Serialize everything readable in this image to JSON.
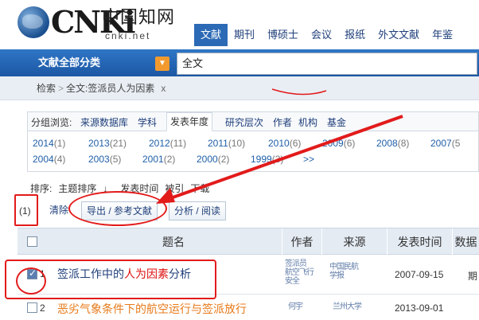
{
  "logo": {
    "word": "CNKi",
    "chinese": "中国知网",
    "url": "cnki.net"
  },
  "nav": [
    "文献",
    "期刊",
    "博硕士",
    "会议",
    "报纸",
    "外文文献",
    "年鉴"
  ],
  "search": {
    "category_label": "文献全部分类",
    "value": "全文"
  },
  "breadcrumb": {
    "home": "检索",
    "sep": ">",
    "current": "全文:签派员人为因素",
    "close": "x"
  },
  "filter": {
    "label": "分组浏览:",
    "tabs": [
      "来源数据库",
      "学科",
      "发表年度",
      "研究层次",
      "作者",
      "机构",
      "基金"
    ],
    "years_row1": [
      {
        "year": "2014",
        "count": "(1)"
      },
      {
        "year": "2013",
        "count": "(21)"
      },
      {
        "year": "2012",
        "count": "(11)"
      },
      {
        "year": "2011",
        "count": "(10)"
      },
      {
        "year": "2010",
        "count": "(6)"
      },
      {
        "year": "2009",
        "count": "(6)"
      },
      {
        "year": "2008",
        "count": "(8)"
      },
      {
        "year": "2007",
        "count": "(5"
      }
    ],
    "years_row2": [
      {
        "year": "2004",
        "count": "(4)"
      },
      {
        "year": "2003",
        "count": "(5)"
      },
      {
        "year": "2001",
        "count": "(2)"
      },
      {
        "year": "2000",
        "count": "(2)"
      },
      {
        "year": "1999",
        "count": "(3)"
      }
    ],
    "more": ">>"
  },
  "sort": {
    "label": "排序:",
    "items": [
      "主题排序",
      "发表时间",
      "被引",
      "下载"
    ],
    "arrow": "↓"
  },
  "actions": {
    "count": "(1)",
    "clear": "清除",
    "export": "导出 / 参考文献",
    "analyze": "分析 / 阅读"
  },
  "table": {
    "headers": {
      "title": "题名",
      "author": "作者",
      "source": "来源",
      "date": "发表时间",
      "db": "数据"
    },
    "rows": [
      {
        "num": "1",
        "title_pre": "签派工作中的",
        "title_hl": "人为因素",
        "title_post": "分析",
        "author_garbled": "签派员\n航空飞行\n安全",
        "source_garbled": "中国民航\n学报",
        "date": "2007-09-15",
        "db": "期"
      },
      {
        "num": "2",
        "title": "恶劣气象条件下的航空运行与签派放行",
        "author_garbled": "何宇",
        "source_garbled": "兰州大学",
        "date": "2013-09-01"
      }
    ]
  }
}
